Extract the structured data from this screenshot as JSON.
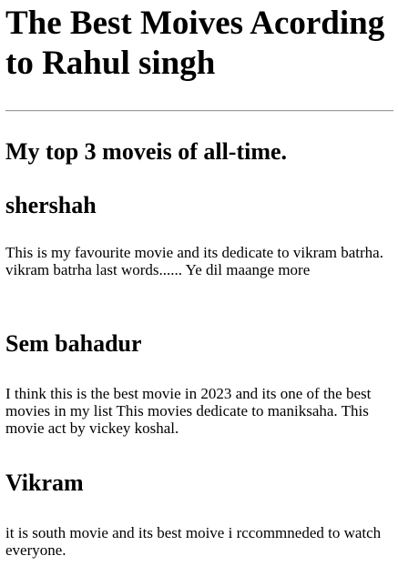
{
  "header": {
    "title": "The Best Moives Acording to Rahul singh"
  },
  "subtitle": "My top 3 moveis of all-time.",
  "movies": [
    {
      "title": "shershah",
      "description": "This is my favourite movie and its dedicate to vikram batrha. vikram batrha last words...... Ye dil maange more"
    },
    {
      "title": "Sem bahadur",
      "description": "I think this is the best movie in 2023 and its one of the best movies in my list This movies dedicate to maniksaha. This movie act by vickey koshal."
    },
    {
      "title": "Vikram",
      "description": "it is south movie and its best moive i rccommneded to watch everyone."
    }
  ]
}
